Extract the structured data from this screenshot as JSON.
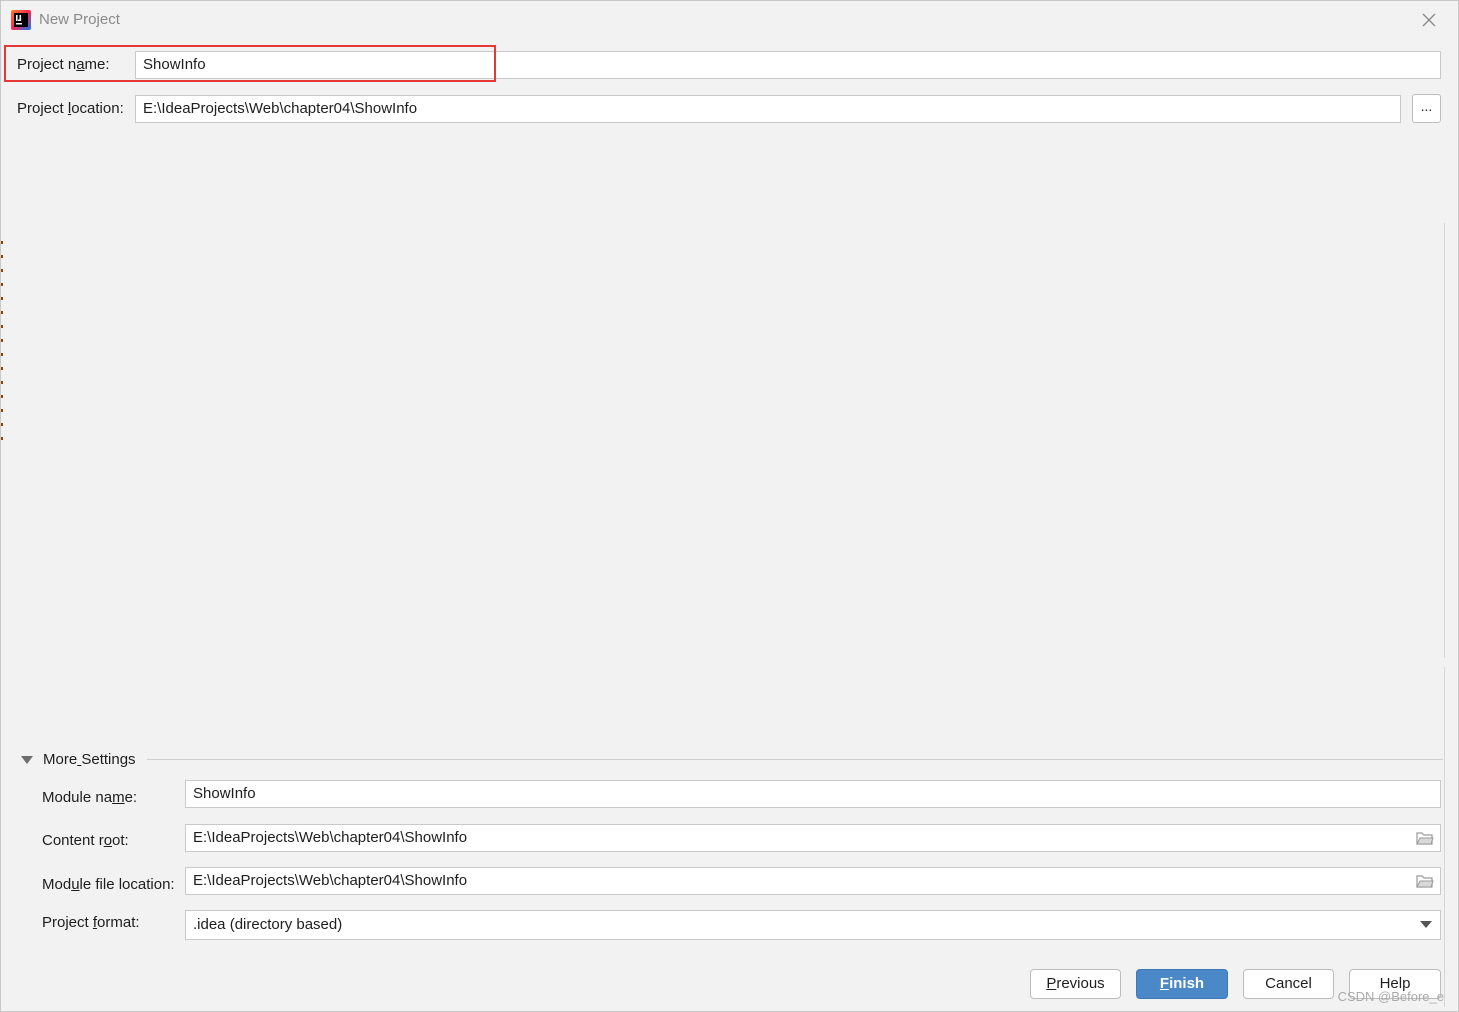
{
  "window": {
    "title": "New Project"
  },
  "project": {
    "name_label_pre": "Project n",
    "name_label_u": "a",
    "name_label_post": "me:",
    "name_value": "ShowInfo",
    "location_label_pre": "Project ",
    "location_label_u": "l",
    "location_label_post": "ocation:",
    "location_value": "E:\\IdeaProjects\\Web\\chapter04\\ShowInfo",
    "browse_label": "..."
  },
  "more_settings": {
    "title_pre": "More",
    "title_u": " ",
    "title_post": "Settings",
    "module_name_label_pre": "Module na",
    "module_name_label_u": "m",
    "module_name_label_post": "e:",
    "module_name_value": "ShowInfo",
    "content_root_label_pre": "Content r",
    "content_root_label_u": "o",
    "content_root_label_post": "ot:",
    "content_root_value": "E:\\IdeaProjects\\Web\\chapter04\\ShowInfo",
    "module_file_label_pre": "Mod",
    "module_file_label_u": "u",
    "module_file_label_post": "le file location:",
    "module_file_value": "E:\\IdeaProjects\\Web\\chapter04\\ShowInfo",
    "format_label_pre": "Project ",
    "format_label_u": "f",
    "format_label_post": "ormat:",
    "format_value": ".idea (directory based)"
  },
  "buttons": {
    "previous_u": "P",
    "previous_rest": "revious",
    "finish_u": "F",
    "finish_rest": "inish",
    "cancel": "Cancel",
    "help": "Help"
  },
  "watermark": "CSDN @Before_e",
  "colors": {
    "accent": "#4a88c7",
    "highlight": "#e53935"
  },
  "icons": {
    "app": "intellij-idea-icon",
    "close": "close-icon",
    "folder": "folder-icon",
    "toggle": "triangle-down-icon",
    "dropdown": "chevron-down-icon"
  }
}
